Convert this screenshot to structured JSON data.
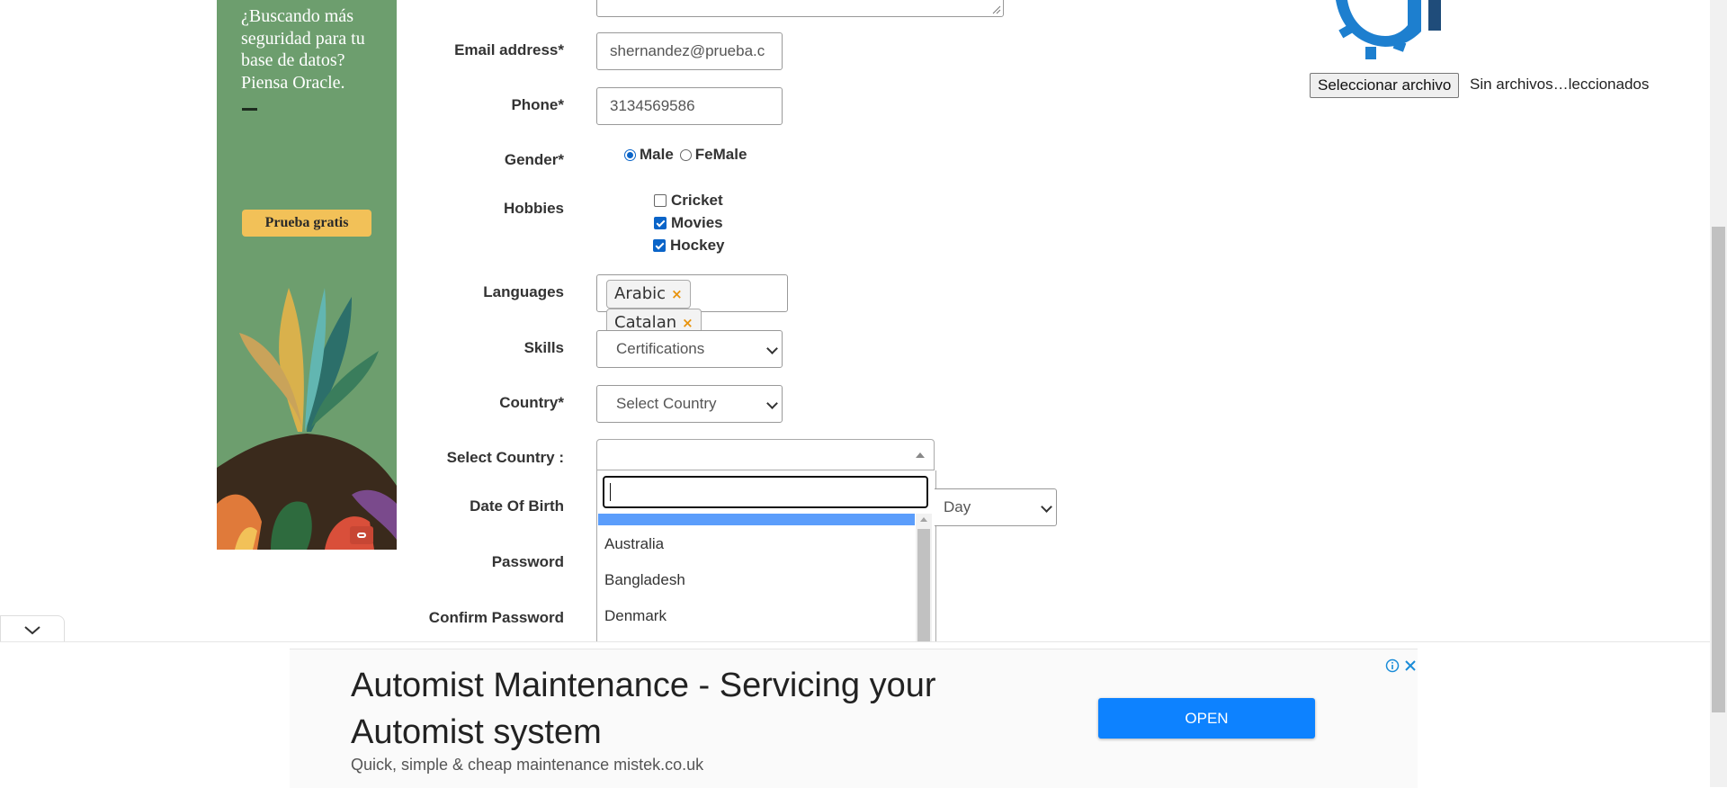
{
  "side_ad": {
    "headline": "¿Buscando más seguridad para tu base de datos? Piensa Oracle.",
    "cta": "Prueba gratis"
  },
  "form": {
    "email": {
      "label": "Email address*",
      "value": "shernandez@prueba.c"
    },
    "phone": {
      "label": "Phone*",
      "value": "3134569586"
    },
    "gender": {
      "label": "Gender*",
      "options": [
        "Male",
        "FeMale"
      ],
      "selected": "Male"
    },
    "hobbies": {
      "label": "Hobbies",
      "options": [
        "Cricket",
        "Movies",
        "Hockey"
      ],
      "checked": [
        "Movies",
        "Hockey"
      ]
    },
    "languages": {
      "label": "Languages",
      "tags": [
        "Arabic",
        "Catalan"
      ]
    },
    "skills": {
      "label": "Skills",
      "value": "Certifications"
    },
    "country": {
      "label": "Country*",
      "value": "Select Country"
    },
    "select_country": {
      "label": "Select Country :",
      "value": "",
      "search_value": "",
      "options": [
        "",
        "Australia",
        "Bangladesh",
        "Denmark"
      ]
    },
    "dob": {
      "label": "Date Of Birth",
      "day_value": "Day"
    },
    "password": {
      "label": "Password"
    },
    "confirm_password": {
      "label": "Confirm Password"
    }
  },
  "file_upload": {
    "button": "Seleccionar archivo",
    "status": "Sin archivos…leccionados"
  },
  "bottom_ad": {
    "title": "Automist Maintenance - Servicing your Automist system",
    "subtitle": "Quick, simple & cheap maintenance mistek.co.uk",
    "cta": "OPEN"
  },
  "colors": {
    "accent": "#0a64c8",
    "ad_green": "#6d9e6e",
    "ad_button": "#f2c158",
    "open_button": "#0d82ff",
    "dropdown_highlight": "#5b9dfb",
    "tag_remove": "#e8930c"
  }
}
